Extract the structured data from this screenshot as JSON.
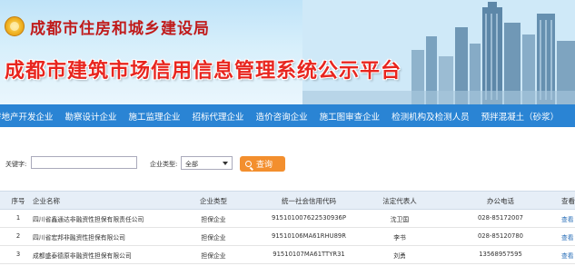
{
  "header": {
    "bureau_name": "成都市住房和城乡建设局",
    "system_title": "成都市建筑市场信用信息管理系统公示平台"
  },
  "nav": {
    "items": [
      "房地产开发企业",
      "勘察设计企业",
      "施工监理企业",
      "招标代理企业",
      "造价咨询企业",
      "施工图审查企业",
      "检测机构及检测人员",
      "预拌混凝土（砂浆）"
    ]
  },
  "search": {
    "keyword_label": "关键字:",
    "keyword_value": "",
    "type_label": "企业类型:",
    "type_selected": "全部",
    "query_button": "查询",
    "query_icon": "search-icon"
  },
  "table": {
    "headers": {
      "num": "序号",
      "name": "企业名称",
      "type": "企业类型",
      "code": "统一社会信用代码",
      "rep": "法定代表人",
      "phone": "办公电话",
      "view": "查看"
    },
    "rows": [
      {
        "num": "1",
        "name": "四川省鑫通达非融资性担保有限责任公司",
        "type": "担保企业",
        "code": "915101007622530936P",
        "rep": "沈卫国",
        "phone": "028-85172007",
        "view": "查看"
      },
      {
        "num": "2",
        "name": "四川省宏邦非融资性担保有限公司",
        "type": "担保企业",
        "code": "91510106MA61RHU89R",
        "rep": "李书",
        "phone": "028-85120780",
        "view": "查看"
      },
      {
        "num": "3",
        "name": "成都盛泰德原非融资性担保有限公司",
        "type": "担保企业",
        "code": "91510107MA61TTYR31",
        "rep": "刘勇",
        "phone": "13568957595",
        "view": "查看"
      }
    ]
  },
  "colors": {
    "nav_bg": "#2a84d4",
    "title_red": "#e8251e",
    "button_orange": "#f38f2e",
    "header_row_bg": "#e6eef7"
  }
}
